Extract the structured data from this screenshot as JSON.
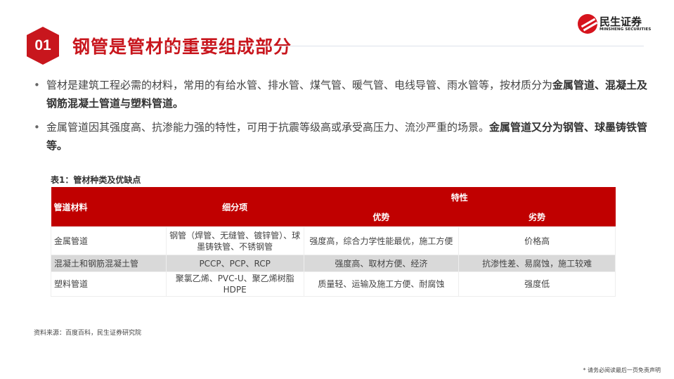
{
  "header": {
    "number": "01",
    "title": "钢管是管材的重要组成部分",
    "logo_cn": "民生证券",
    "logo_en": "MINSHENG SECURITIES"
  },
  "bullets": [
    {
      "text": "管材是建筑工程必需的材料，常用的有给水管、排水管、煤气管、暖气管、电线导管、雨水管等，按材质分为",
      "bold": "金属管道、混凝土及钢筋混凝土管道与塑料管道。"
    },
    {
      "text": "金属管道因其强度高、抗渗能力强的特性，可用于抗震等级高或承受高压力、流沙严重的场景。",
      "bold": "金属管道又分为钢管、球墨铸铁管等。"
    }
  ],
  "table": {
    "caption": "表1：管材种类及优缺点",
    "headers": {
      "material": "管道材料",
      "sub": "细分项",
      "traits": "特性",
      "pros": "优势",
      "cons": "劣势"
    },
    "rows": [
      [
        "金属管道",
        "钢管（焊管、无缝管、镀锌管）、球墨铸铁管、不锈钢管",
        "强度高，综合力学性能最优，施工方便",
        "价格高"
      ],
      [
        "混凝土和钢筋混凝土管",
        "PCCP、PCP、RCP",
        "强度高、取材方便、经济",
        "抗渗性差、易腐蚀，施工较难"
      ],
      [
        "塑料管道",
        "聚氯乙烯、PVC-U、聚乙烯树脂 HDPE",
        "质量轻、运输及施工方便、耐腐蚀",
        "强度低"
      ]
    ]
  },
  "footer": {
    "source": "资料来源：百度百科，民生证券研究院",
    "disclaimer": "* 请务必阅读最后一页免责声明"
  }
}
